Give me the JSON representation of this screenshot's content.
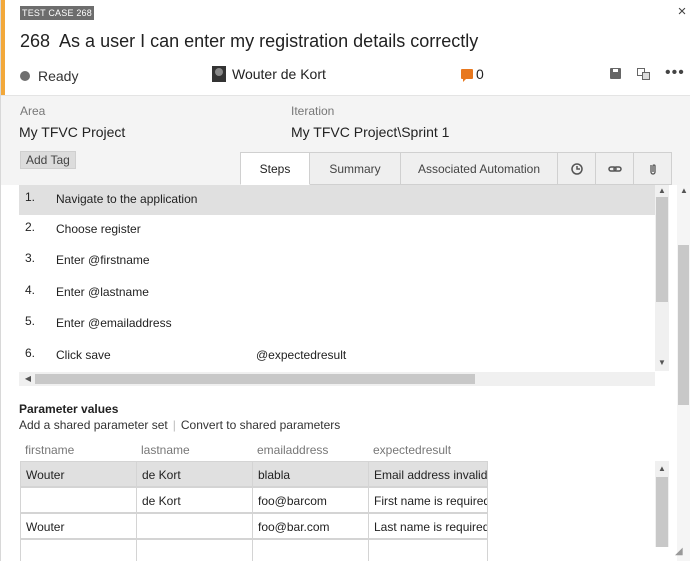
{
  "header": {
    "work_item_type": "TEST CASE 268",
    "id": "268",
    "title": "As a user I can enter my registration details correctly",
    "state": "Ready",
    "assigned_to": "Wouter de Kort",
    "comment_count": "0",
    "close_glyph": "×",
    "more_glyph": "•••",
    "accent_color": "#f2a83a"
  },
  "fields": {
    "area_label": "Area",
    "area_value": "My TFVC Project",
    "iteration_label": "Iteration",
    "iteration_value": "My TFVC Project\\Sprint 1",
    "add_tag_label": "Add Tag"
  },
  "tabs": [
    {
      "label": "Steps",
      "active": true
    },
    {
      "label": "Summary",
      "active": false
    },
    {
      "label": "Associated Automation",
      "active": false
    }
  ],
  "tab_icons": [
    "history-icon",
    "link-icon",
    "attachment-icon"
  ],
  "steps": [
    {
      "num": "1.",
      "action": "Navigate to the application",
      "expected": ""
    },
    {
      "num": "2.",
      "action": "Choose register",
      "expected": ""
    },
    {
      "num": "3.",
      "action": "Enter @firstname",
      "expected": ""
    },
    {
      "num": "4.",
      "action": "Enter @lastname",
      "expected": ""
    },
    {
      "num": "5.",
      "action": "Enter @emailaddress",
      "expected": ""
    },
    {
      "num": "6.",
      "action": "Click save",
      "expected": "@expectedresult"
    }
  ],
  "parameters": {
    "heading": "Parameter values",
    "add_shared_label": "Add a shared parameter set",
    "separator": "|",
    "convert_label": "Convert to shared parameters",
    "columns": [
      "firstname",
      "lastname",
      "emailaddress",
      "expectedresult"
    ],
    "rows": [
      [
        "Wouter",
        "de Kort",
        "blabla",
        "Email address invalid"
      ],
      [
        "",
        "de Kort",
        "foo@barcom",
        "First name is required"
      ],
      [
        "Wouter",
        "",
        "foo@bar.com",
        "Last name is required"
      ],
      [
        "",
        "",
        "",
        ""
      ]
    ]
  }
}
